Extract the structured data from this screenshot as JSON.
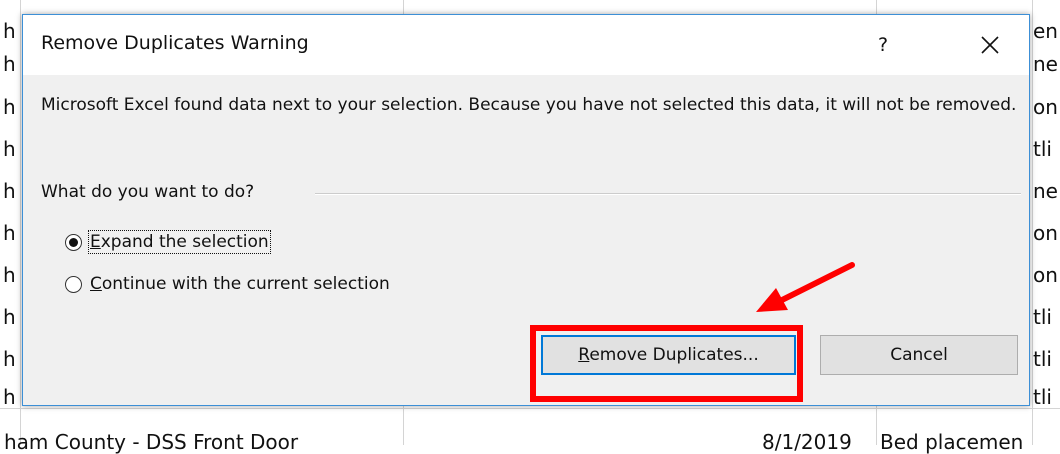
{
  "background": {
    "left_col_letters": [
      "h",
      "h",
      "h",
      "h",
      "h",
      "h",
      "h",
      "h",
      "h",
      "h"
    ],
    "right_col_fragments": [
      "en",
      "ne",
      "on",
      "tli",
      "ne",
      "on",
      "on",
      "tli",
      "tli",
      "tli"
    ],
    "bottom_row": {
      "left": "ham County - DSS Front Door",
      "date": "8/1/2019",
      "right": "Bed placemen"
    }
  },
  "dialog": {
    "title": "Remove Duplicates Warning",
    "help_label": "?",
    "message": "Microsoft Excel found data next to your selection. Because you have not selected this data, it will not be removed.",
    "question": "What do you want to do?",
    "options": [
      {
        "accel": "E",
        "rest": "xpand the selection",
        "checked": true
      },
      {
        "accel": "C",
        "rest": "ontinue with the current selection",
        "checked": false
      }
    ],
    "primary_button": {
      "accel": "R",
      "rest": "emove Duplicates..."
    },
    "cancel_label": "Cancel"
  },
  "colors": {
    "accent": "#0078d7",
    "highlight": "#ff0000",
    "dialog_bg": "#f0f0f0"
  }
}
